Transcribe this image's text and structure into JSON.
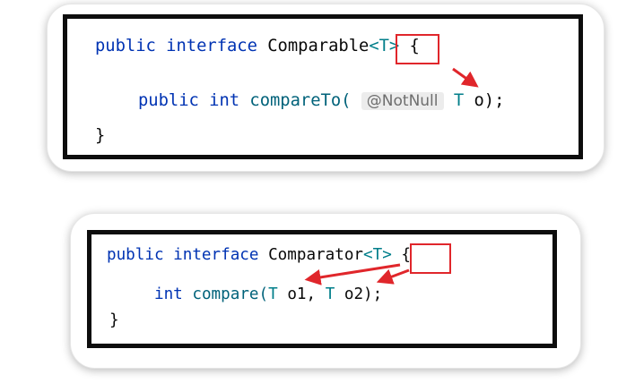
{
  "snippet1": {
    "line1": {
      "kw1": "public",
      "kw2": "interface",
      "name": "Comparable",
      "generic": "<T>",
      "brace": "{"
    },
    "line2": {
      "kw1": "public",
      "kw2": "int",
      "method": "compareTo(",
      "annotation": "@NotNull",
      "type": "T",
      "param": "o);"
    },
    "line3": "}"
  },
  "snippet2": {
    "line1": {
      "kw1": "public",
      "kw2": "interface",
      "name": "Comparator",
      "generic": "<T>",
      "brace": "{"
    },
    "line2": {
      "kw1": "int",
      "method": "compare(",
      "type1": "T",
      "param1": "o1,",
      "type2": "T",
      "param2": "o2);"
    },
    "line3": "}"
  },
  "colors": {
    "keyword": "#0033b3",
    "method": "#00627a",
    "type_param": "#007e8a",
    "plain": "#080808",
    "highlight": "#e0262b",
    "frame": "#0d0d0d"
  }
}
